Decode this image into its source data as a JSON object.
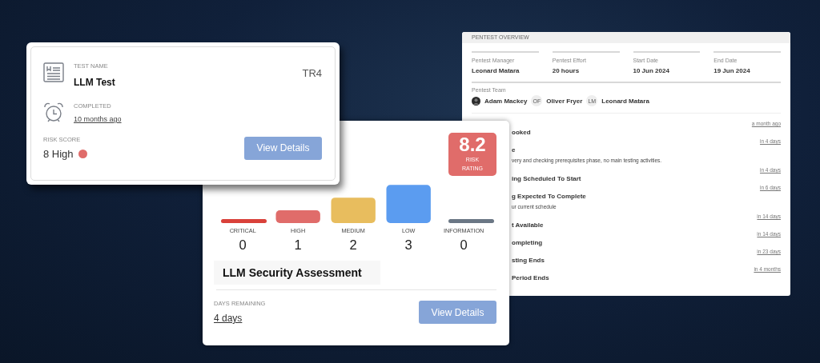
{
  "test_card": {
    "test_name_label": "TEST NAME",
    "test_name": "LLM Test",
    "code": "TR4",
    "status_label": "COMPLETED",
    "status_time": "10 months ago",
    "risk_label": "RISK SCORE",
    "risk": {
      "score": "8 High",
      "color": "#e06c6a"
    },
    "button": "View Details"
  },
  "assessment_card": {
    "risk_rating": {
      "value": "8.2",
      "label": "RISK RATING",
      "color": "#e06c6a"
    },
    "chart_data": {
      "type": "bar",
      "categories": [
        "CRITICAL",
        "HIGH",
        "MEDIUM",
        "LOW",
        "INFORMATION"
      ],
      "values": [
        0,
        1,
        2,
        3,
        0
      ],
      "data_labels": true,
      "colors": [
        "#d9413a",
        "#e06c6a",
        "#e8bd5e",
        "#5b9cf0",
        "#6b7785"
      ]
    },
    "title": "LLM Security Assessment",
    "days_label": "DAYS REMAINING",
    "days": "4 days",
    "button": "View Details"
  },
  "overview": {
    "title": "PENTEST OVERVIEW",
    "fields": [
      {
        "label": "Pentest Manager",
        "value": "Leonard Matara"
      },
      {
        "label": "Pentest Effort",
        "value": "20 hours"
      },
      {
        "label": "Start Date",
        "value": "10 Jun 2024"
      },
      {
        "label": "End Date",
        "value": "19 Jun 2024"
      }
    ],
    "team_label": "Pentest Team",
    "team": [
      {
        "name": "Adam Mackey",
        "kind": "photo"
      },
      {
        "name": "Oliver Fryer",
        "kind": "initials",
        "initials": "OF"
      },
      {
        "name": "Leonard Matara",
        "kind": "initials",
        "initials": "LM"
      }
    ],
    "events": [
      {
        "time": "a month ago",
        "title": "ooked"
      },
      {
        "time": "in 4 days",
        "title": "e",
        "description": "very and checking prerequisites phase, no main testing activities."
      },
      {
        "time": "in 4 days",
        "title": "ing Scheduled To Start"
      },
      {
        "time": "in 6 days",
        "title": "g Expected To Complete",
        "description": "ur current schedule"
      },
      {
        "time": "in 14 days",
        "title": "t Available"
      },
      {
        "time": "in 14 days",
        "title": "ompleting"
      },
      {
        "time": "in 23 days",
        "title": "sting Ends"
      },
      {
        "time": "in 4 months",
        "title": "Period Ends"
      }
    ]
  }
}
